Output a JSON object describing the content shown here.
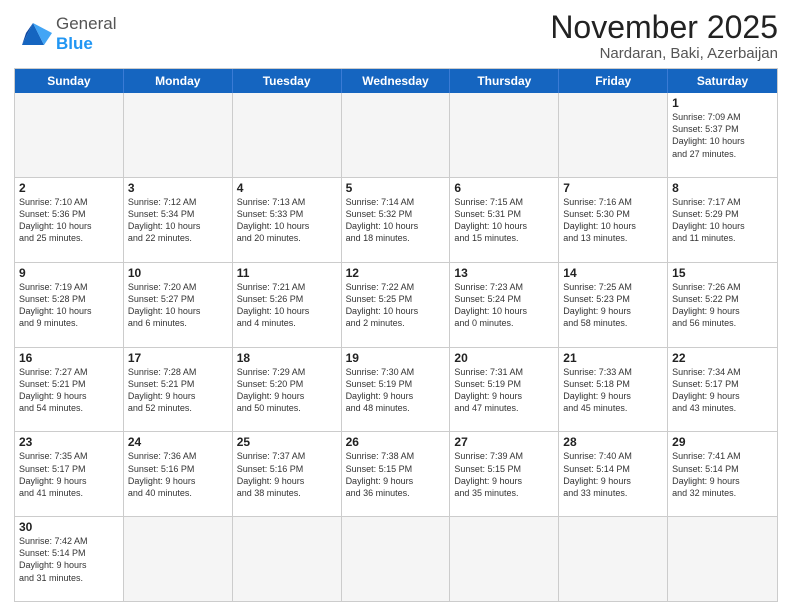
{
  "logo": {
    "line1": "General",
    "line2": "Blue"
  },
  "title": "November 2025",
  "subtitle": "Nardaran, Baki, Azerbaijan",
  "weekdays": [
    "Sunday",
    "Monday",
    "Tuesday",
    "Wednesday",
    "Thursday",
    "Friday",
    "Saturday"
  ],
  "rows": [
    [
      {
        "day": "",
        "info": ""
      },
      {
        "day": "",
        "info": ""
      },
      {
        "day": "",
        "info": ""
      },
      {
        "day": "",
        "info": ""
      },
      {
        "day": "",
        "info": ""
      },
      {
        "day": "",
        "info": ""
      },
      {
        "day": "1",
        "info": "Sunrise: 7:09 AM\nSunset: 5:37 PM\nDaylight: 10 hours\nand 27 minutes."
      }
    ],
    [
      {
        "day": "2",
        "info": "Sunrise: 7:10 AM\nSunset: 5:36 PM\nDaylight: 10 hours\nand 25 minutes."
      },
      {
        "day": "3",
        "info": "Sunrise: 7:12 AM\nSunset: 5:34 PM\nDaylight: 10 hours\nand 22 minutes."
      },
      {
        "day": "4",
        "info": "Sunrise: 7:13 AM\nSunset: 5:33 PM\nDaylight: 10 hours\nand 20 minutes."
      },
      {
        "day": "5",
        "info": "Sunrise: 7:14 AM\nSunset: 5:32 PM\nDaylight: 10 hours\nand 18 minutes."
      },
      {
        "day": "6",
        "info": "Sunrise: 7:15 AM\nSunset: 5:31 PM\nDaylight: 10 hours\nand 15 minutes."
      },
      {
        "day": "7",
        "info": "Sunrise: 7:16 AM\nSunset: 5:30 PM\nDaylight: 10 hours\nand 13 minutes."
      },
      {
        "day": "8",
        "info": "Sunrise: 7:17 AM\nSunset: 5:29 PM\nDaylight: 10 hours\nand 11 minutes."
      }
    ],
    [
      {
        "day": "9",
        "info": "Sunrise: 7:19 AM\nSunset: 5:28 PM\nDaylight: 10 hours\nand 9 minutes."
      },
      {
        "day": "10",
        "info": "Sunrise: 7:20 AM\nSunset: 5:27 PM\nDaylight: 10 hours\nand 6 minutes."
      },
      {
        "day": "11",
        "info": "Sunrise: 7:21 AM\nSunset: 5:26 PM\nDaylight: 10 hours\nand 4 minutes."
      },
      {
        "day": "12",
        "info": "Sunrise: 7:22 AM\nSunset: 5:25 PM\nDaylight: 10 hours\nand 2 minutes."
      },
      {
        "day": "13",
        "info": "Sunrise: 7:23 AM\nSunset: 5:24 PM\nDaylight: 10 hours\nand 0 minutes."
      },
      {
        "day": "14",
        "info": "Sunrise: 7:25 AM\nSunset: 5:23 PM\nDaylight: 9 hours\nand 58 minutes."
      },
      {
        "day": "15",
        "info": "Sunrise: 7:26 AM\nSunset: 5:22 PM\nDaylight: 9 hours\nand 56 minutes."
      }
    ],
    [
      {
        "day": "16",
        "info": "Sunrise: 7:27 AM\nSunset: 5:21 PM\nDaylight: 9 hours\nand 54 minutes."
      },
      {
        "day": "17",
        "info": "Sunrise: 7:28 AM\nSunset: 5:21 PM\nDaylight: 9 hours\nand 52 minutes."
      },
      {
        "day": "18",
        "info": "Sunrise: 7:29 AM\nSunset: 5:20 PM\nDaylight: 9 hours\nand 50 minutes."
      },
      {
        "day": "19",
        "info": "Sunrise: 7:30 AM\nSunset: 5:19 PM\nDaylight: 9 hours\nand 48 minutes."
      },
      {
        "day": "20",
        "info": "Sunrise: 7:31 AM\nSunset: 5:19 PM\nDaylight: 9 hours\nand 47 minutes."
      },
      {
        "day": "21",
        "info": "Sunrise: 7:33 AM\nSunset: 5:18 PM\nDaylight: 9 hours\nand 45 minutes."
      },
      {
        "day": "22",
        "info": "Sunrise: 7:34 AM\nSunset: 5:17 PM\nDaylight: 9 hours\nand 43 minutes."
      }
    ],
    [
      {
        "day": "23",
        "info": "Sunrise: 7:35 AM\nSunset: 5:17 PM\nDaylight: 9 hours\nand 41 minutes."
      },
      {
        "day": "24",
        "info": "Sunrise: 7:36 AM\nSunset: 5:16 PM\nDaylight: 9 hours\nand 40 minutes."
      },
      {
        "day": "25",
        "info": "Sunrise: 7:37 AM\nSunset: 5:16 PM\nDaylight: 9 hours\nand 38 minutes."
      },
      {
        "day": "26",
        "info": "Sunrise: 7:38 AM\nSunset: 5:15 PM\nDaylight: 9 hours\nand 36 minutes."
      },
      {
        "day": "27",
        "info": "Sunrise: 7:39 AM\nSunset: 5:15 PM\nDaylight: 9 hours\nand 35 minutes."
      },
      {
        "day": "28",
        "info": "Sunrise: 7:40 AM\nSunset: 5:14 PM\nDaylight: 9 hours\nand 33 minutes."
      },
      {
        "day": "29",
        "info": "Sunrise: 7:41 AM\nSunset: 5:14 PM\nDaylight: 9 hours\nand 32 minutes."
      }
    ],
    [
      {
        "day": "30",
        "info": "Sunrise: 7:42 AM\nSunset: 5:14 PM\nDaylight: 9 hours\nand 31 minutes."
      },
      {
        "day": "",
        "info": ""
      },
      {
        "day": "",
        "info": ""
      },
      {
        "day": "",
        "info": ""
      },
      {
        "day": "",
        "info": ""
      },
      {
        "day": "",
        "info": ""
      },
      {
        "day": "",
        "info": ""
      }
    ]
  ]
}
